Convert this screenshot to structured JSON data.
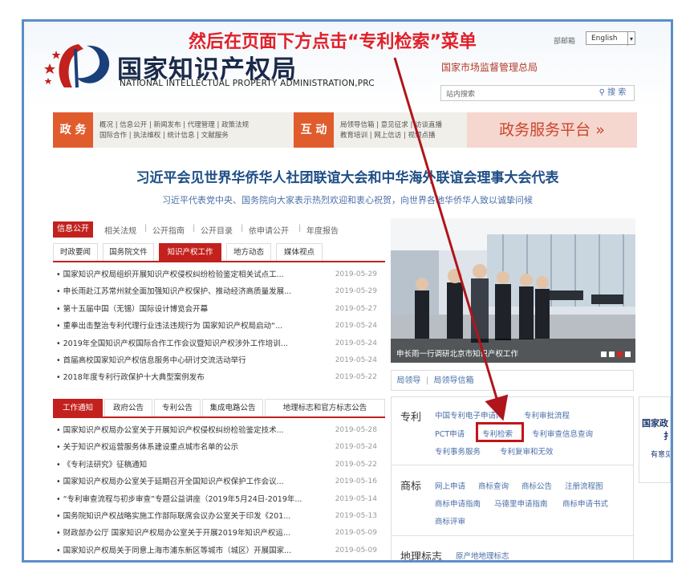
{
  "annotation": "然后在页面下方点击“专利检索”菜单",
  "header": {
    "logo_cn": "国家知识产权局",
    "logo_en": "NATIONAL INTELLECTUAL PROPERTY ADMINISTRATION,PRC",
    "mail_link": "部邮箱",
    "lang_value": "English",
    "parent_org": "国家市场监督管理总局",
    "search_placeholder": "站内搜索",
    "search_btn": "搜 索"
  },
  "nav": {
    "gov_label": "政 务",
    "gov_links_1": "概况 | 信息公开 | 新闻发布 | 代理管理 | 政策法规",
    "gov_links_2": "国际合作 | 执法维权 | 统计信息 | 文献服务",
    "interact_label": "互 动",
    "interact_links_1": "局领导信箱 | 意见征求 | 访谈直播",
    "interact_links_2": "教育培训 | 网上信访 | 视频点播",
    "service_platform": "政务服务平台 »"
  },
  "headline": "习近平会见世界华侨华人社团联谊大会和中华海外联谊会理事大会代表",
  "subheadline": "习近平代表党中央、国务院向大家表示热烈欢迎和衷心祝贺，向世界各地华侨华人致以诚挚问候",
  "info_bar": {
    "tag": "信息公开",
    "links": [
      "相关法规",
      "公开指南",
      "公开目录",
      "依申请公开",
      "年度报告"
    ]
  },
  "tabs1": [
    "时政要闻",
    "国务院文件",
    "知识产权工作",
    "地方动态",
    "媒体视点"
  ],
  "news1": [
    {
      "text": "国家知识产权局组织开展知识产权侵权纠纷检验鉴定相关试点工...",
      "date": "2019-05-29"
    },
    {
      "text": "申长雨赴江苏常州就全面加强知识产权保护、推动经济高质量发展...",
      "date": "2019-05-29"
    },
    {
      "text": "第十五届中国（无锡）国际设计博览会开幕",
      "date": "2019-05-27"
    },
    {
      "text": "重拳出击整治专利代理行业违法违规行为 国家知识产权局启动“...",
      "date": "2019-05-24"
    },
    {
      "text": "2019年全国知识产权国际合作工作会议暨知识产权涉外工作培训...",
      "date": "2019-05-24"
    },
    {
      "text": "首届高校国家知识产权信息服务中心研讨交流活动举行",
      "date": "2019-05-24"
    },
    {
      "text": "2018年度专利行政保护十大典型案例发布",
      "date": "2019-05-22"
    }
  ],
  "tabs2": [
    "工作通知",
    "政府公告",
    "专利公告",
    "集成电路公告",
    "地理标志和官方标志公告"
  ],
  "news2": [
    {
      "text": "国家知识产权局办公室关于开展知识产权侵权纠纷检验鉴定技术...",
      "date": "2019-05-28"
    },
    {
      "text": "关于知识产权运营服务体系建设重点城市名单的公示",
      "date": "2019-05-24"
    },
    {
      "text": "《专利法研究》征稿通知",
      "date": "2019-05-22"
    },
    {
      "text": "国家知识产权局办公室关于延期召开全国知识产权保护工作会议...",
      "date": "2019-05-16"
    },
    {
      "text": "“专利审查流程与初步审查”专题公益讲座（2019年5月24日-2019年...",
      "date": "2019-05-14"
    },
    {
      "text": "国务院知识产权战略实施工作部际联席会议办公室关于印发《201...",
      "date": "2019-05-13"
    },
    {
      "text": "财政部办公厅 国家知识产权局办公室关于开展2019年知识产权运...",
      "date": "2019-05-09"
    },
    {
      "text": "国家知识产权局关于同意上海市浦东新区等城市（城区）开展国家...",
      "date": "2019-05-09"
    }
  ],
  "photo_caption": "申长雨一行调研北京市知识产权工作",
  "leaders": {
    "a": "局领导",
    "b": "局领导信箱"
  },
  "services": {
    "patent": {
      "title": "专利",
      "links": [
        "中国专利电子申请网",
        "专利审批流程",
        "PCT申请",
        "专利检索",
        "专利审查信息查询",
        "专利事务服务",
        "专利复审和无效"
      ]
    },
    "trademark": {
      "title": "商标",
      "links": [
        "网上申请",
        "商标查询",
        "商标公告",
        "注册流程图",
        "商标申请指南",
        "马德里申请指南",
        "商标申请书式",
        "商标评审"
      ]
    },
    "geo": {
      "title": "地理标志",
      "links": [
        "原产地地理标志"
      ]
    }
  },
  "right_strip": {
    "line1": "国家政",
    "line2": "扌",
    "line3": "有意见"
  },
  "colors": {
    "accent_red": "#c2211d",
    "annotation_red": "#e0212a",
    "nav_orange": "#e05c2d",
    "link_blue": "#4a6ea8",
    "headline_blue": "#1e4e86",
    "frame_blue": "#5b8ec9"
  }
}
